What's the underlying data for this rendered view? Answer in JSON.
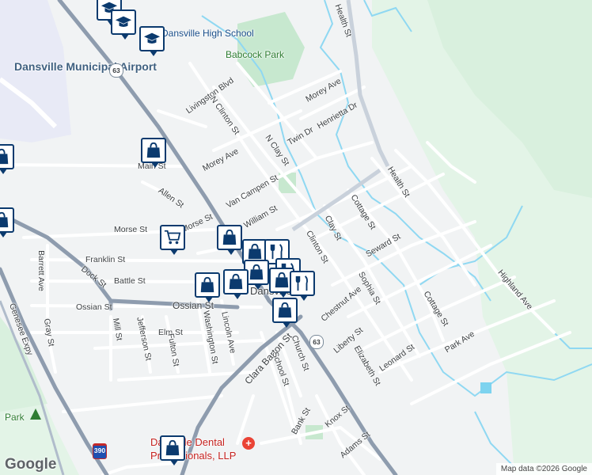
{
  "map": {
    "places": {
      "airport": "Dansville Municipal Airport",
      "high_school": "Dansville High School",
      "park_babcock": "Babcock Park",
      "park_sw": "Park",
      "dental": "Dansville Dental Professionals, LLP",
      "downtown": "Dansville"
    },
    "streets": {
      "health": "Health St",
      "livingston": "Livingston Blvd",
      "n_clinton": "N Clinton St",
      "morey_ave_ne": "Morey Ave",
      "henrietta": "Henrietta Dr",
      "twin": "Twin Dr",
      "n_clay": "N Clay St",
      "morey_ave": "Morey Ave",
      "van_campen": "Van Campen St",
      "william": "William St",
      "allen": "Allen St",
      "morse": "Morse St",
      "morse2": "Morse St",
      "main": "Main St",
      "franklin": "Franklin St",
      "barrett": "Barrett Ave",
      "dock": "Dock St",
      "battle": "Battle St",
      "ossian": "Ossian St",
      "ossian2": "Ossian St",
      "mill": "Mill St",
      "jefferson": "Jefferson St",
      "elm": "Elm St",
      "fulton": "Fulton St",
      "washington": "Washington St",
      "lincoln": "Lincoln Ave",
      "gray": "Gray St",
      "clara_barton": "Clara Barton St",
      "school": "School St",
      "church": "Church St",
      "clay": "Clay St",
      "clinton": "Clinton St",
      "cottage": "Cottage St",
      "cottage2": "Cottage St",
      "health2": "Health St",
      "seward": "Seward St",
      "sophia": "Sophia St",
      "chestnut": "Chestnut Ave",
      "liberty": "Liberty St",
      "elizabeth": "Elizabeth St",
      "leonard": "Leonard St",
      "park_ave": "Park Ave",
      "highland": "Highland Ave",
      "knox": "Knox St",
      "adams": "Adams St",
      "bank": "Bank St",
      "genesee": "Genesee Expy"
    },
    "shields": {
      "route63": "63",
      "route63b": "63",
      "i390": "390"
    },
    "attribution": "Map data ©2026 Google",
    "logo": "Google",
    "colors": {
      "pin_border": "#0b3a6e",
      "road": "#ffffff",
      "highway": "#8e9cae",
      "water": "#7dd3ef",
      "park": "#cfead6",
      "hill": "#e2f3e6"
    },
    "pins": [
      "school-icon",
      "school-icon",
      "school-icon",
      "shopping-bag-icon",
      "shopping-bag-icon",
      "shopping-bag-icon",
      "shopping-cart-icon",
      "shopping-bag-icon",
      "shopping-bag-icon",
      "shopping-bag-icon",
      "shopping-bag-icon",
      "restaurant-icon",
      "restaurant-icon",
      "restaurant-icon",
      "shopping-bag-icon",
      "shopping-bag-icon"
    ]
  }
}
